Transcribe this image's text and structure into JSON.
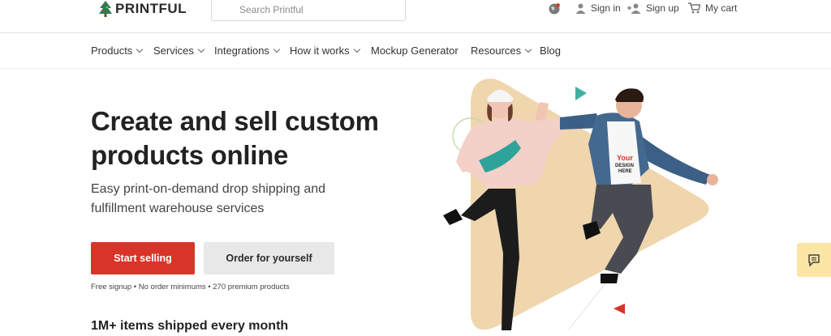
{
  "brand": {
    "logo_text": "PRINTFUL"
  },
  "search": {
    "placeholder": "Search Printful"
  },
  "top_actions": {
    "sign_in": "Sign in",
    "sign_up": "Sign up",
    "cart": "My cart"
  },
  "nav": {
    "items": [
      {
        "label": "Products",
        "dropdown": true
      },
      {
        "label": "Services",
        "dropdown": true
      },
      {
        "label": "Integrations",
        "dropdown": true
      },
      {
        "label": "How it works",
        "dropdown": true
      },
      {
        "label": "Mockup Generator",
        "dropdown": false
      },
      {
        "label": "Resources",
        "dropdown": true
      },
      {
        "label": "Blog",
        "dropdown": false
      }
    ]
  },
  "hero": {
    "title_line1": "Create and sell custom",
    "title_line2": "products online",
    "subtitle_line1": "Easy print-on-demand drop shipping and",
    "subtitle_line2": "fulfillment warehouse services",
    "primary_button": "Start selling",
    "secondary_button": "Order for yourself",
    "fineprint": "Free signup • No order minimums • 270 premium products",
    "shipped": "1M+ items shipped every month"
  },
  "artwork": {
    "tshirt_text": "Your DESIGN HERE"
  },
  "colors": {
    "accent": "#d8342a",
    "secondary_button": "#e8e8e8",
    "chat_bg": "#fbe6a6",
    "triangle_teal": "#3fb0a0",
    "triangle_red": "#d8342a"
  },
  "icons": {
    "globe": "globe-icon",
    "user": "user-icon",
    "add_user": "add-user-icon",
    "cart": "cart-icon",
    "chat": "chat-icon"
  }
}
